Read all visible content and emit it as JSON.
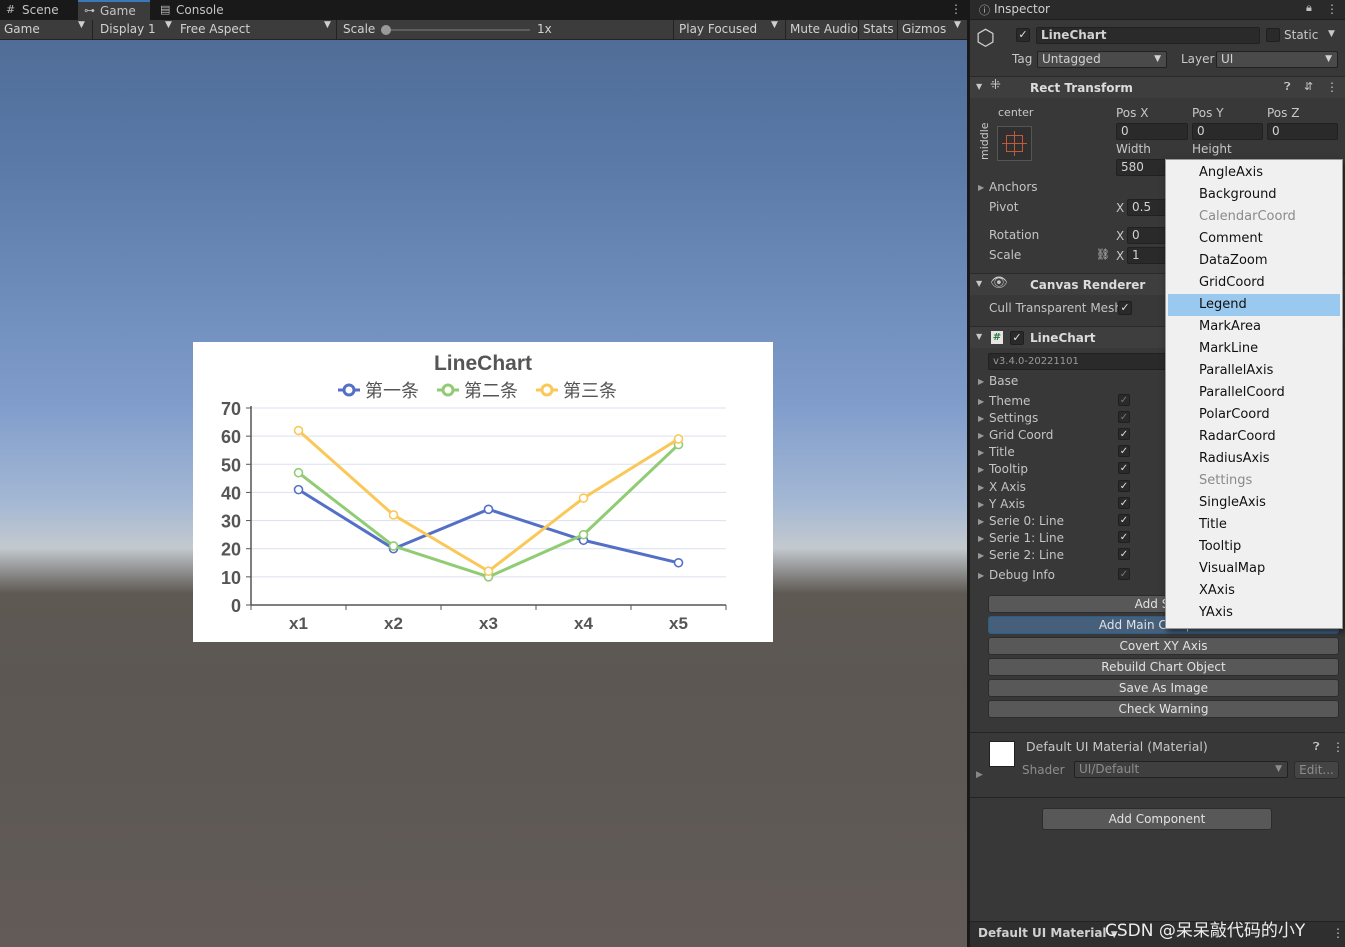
{
  "tabs": [
    {
      "label": "Scene",
      "icon": "grid-icon",
      "active": false
    },
    {
      "label": "Game",
      "icon": "gamepad-icon",
      "active": true
    },
    {
      "label": "Console",
      "icon": "console-icon",
      "active": false
    }
  ],
  "gamebar": {
    "mode": "Game",
    "display": "Display 1",
    "aspect": "Free Aspect",
    "scale_label": "Scale",
    "scale_value": "1x",
    "play_focused": "Play Focused",
    "mute": "Mute Audio",
    "stats": "Stats",
    "gizmos": "Gizmos"
  },
  "chart": {
    "title": "LineChart",
    "legend": [
      {
        "name": "第一条",
        "color": "#5470c6"
      },
      {
        "name": "第二条",
        "color": "#91cc75"
      },
      {
        "name": "第三条",
        "color": "#fac858"
      }
    ]
  },
  "chart_data": {
    "type": "line",
    "title": "LineChart",
    "categories": [
      "x1",
      "x2",
      "x3",
      "x4",
      "x5"
    ],
    "yticks": [
      "0",
      "10",
      "20",
      "30",
      "40",
      "50",
      "60",
      "70"
    ],
    "ylim": [
      0,
      70
    ],
    "legend_position": "top",
    "series": [
      {
        "name": "第一条",
        "color": "#5470c6",
        "values": [
          41,
          20,
          34,
          23,
          15
        ]
      },
      {
        "name": "第二条",
        "color": "#91cc75",
        "values": [
          47,
          21,
          10,
          25,
          57
        ]
      },
      {
        "name": "第三条",
        "color": "#fac858",
        "values": [
          62,
          32,
          12,
          38,
          59
        ]
      }
    ]
  },
  "inspector": {
    "tab": "Inspector",
    "object_name": "LineChart",
    "static_label": "Static",
    "tag_label": "Tag",
    "tag_value": "Untagged",
    "layer_label": "Layer",
    "layer_value": "UI",
    "rect_transform": {
      "title": "Rect Transform",
      "anchor_h": "center",
      "anchor_v": "middle",
      "posx_label": "Pos X",
      "posy_label": "Pos Y",
      "posz_label": "Pos Z",
      "posx": "0",
      "posy": "0",
      "posz": "0",
      "width_label": "Width",
      "height_label": "Height",
      "width": "580",
      "anchors": "Anchors",
      "pivot": "Pivot",
      "pivot_x_label": "X",
      "pivot_x": "0.5",
      "rotation": "Rotation",
      "rot_x_label": "X",
      "rot_x": "0",
      "scale": "Scale",
      "scale_x_label": "X",
      "scale_x": "1"
    },
    "canvas_renderer": {
      "title": "Canvas Renderer",
      "cull": "Cull Transparent Mesh"
    },
    "linechart": {
      "title": "LineChart",
      "version": "v3.4.0-20221101",
      "items": [
        {
          "label": "Base",
          "check": ""
        },
        {
          "label": "Theme",
          "check": "dim"
        },
        {
          "label": "Settings",
          "check": "dim"
        },
        {
          "label": "Grid Coord",
          "check": "on"
        },
        {
          "label": "Title",
          "check": "on"
        },
        {
          "label": "Tooltip",
          "check": "on"
        },
        {
          "label": "X Axis",
          "check": "on"
        },
        {
          "label": "Y Axis",
          "check": "on"
        },
        {
          "label": "Serie 0: Line",
          "check": "on"
        },
        {
          "label": "Serie 1: Line",
          "check": "on"
        },
        {
          "label": "Serie 2: Line",
          "check": "on"
        },
        {
          "label": "Debug Info",
          "check": "dim"
        }
      ],
      "buttons": [
        "Add Serie",
        "Add Main Component",
        "Covert XY Axis",
        "Rebuild Chart Object",
        "Save As Image",
        "Check Warning"
      ]
    },
    "material": {
      "name": "Default UI Material (Material)",
      "shader_label": "Shader",
      "shader_value": "UI/Default",
      "edit": "Edit..."
    },
    "add_component": "Add Component",
    "footer": "Default UI Material"
  },
  "dropdown_menu": {
    "items": [
      {
        "label": "AngleAxis",
        "state": "normal"
      },
      {
        "label": "Background",
        "state": "normal"
      },
      {
        "label": "CalendarCoord",
        "state": "disabled"
      },
      {
        "label": "Comment",
        "state": "normal"
      },
      {
        "label": "DataZoom",
        "state": "normal"
      },
      {
        "label": "GridCoord",
        "state": "normal"
      },
      {
        "label": "Legend",
        "state": "highlighted"
      },
      {
        "label": "MarkArea",
        "state": "normal"
      },
      {
        "label": "MarkLine",
        "state": "normal"
      },
      {
        "label": "ParallelAxis",
        "state": "normal"
      },
      {
        "label": "ParallelCoord",
        "state": "normal"
      },
      {
        "label": "PolarCoord",
        "state": "normal"
      },
      {
        "label": "RadarCoord",
        "state": "normal"
      },
      {
        "label": "RadiusAxis",
        "state": "normal"
      },
      {
        "label": "Settings",
        "state": "disabled"
      },
      {
        "label": "SingleAxis",
        "state": "normal"
      },
      {
        "label": "Title",
        "state": "normal"
      },
      {
        "label": "Tooltip",
        "state": "normal"
      },
      {
        "label": "VisualMap",
        "state": "normal"
      },
      {
        "label": "XAxis",
        "state": "normal"
      },
      {
        "label": "YAxis",
        "state": "normal"
      }
    ]
  },
  "watermark": "CSDN @呆呆敲代码的小Y"
}
